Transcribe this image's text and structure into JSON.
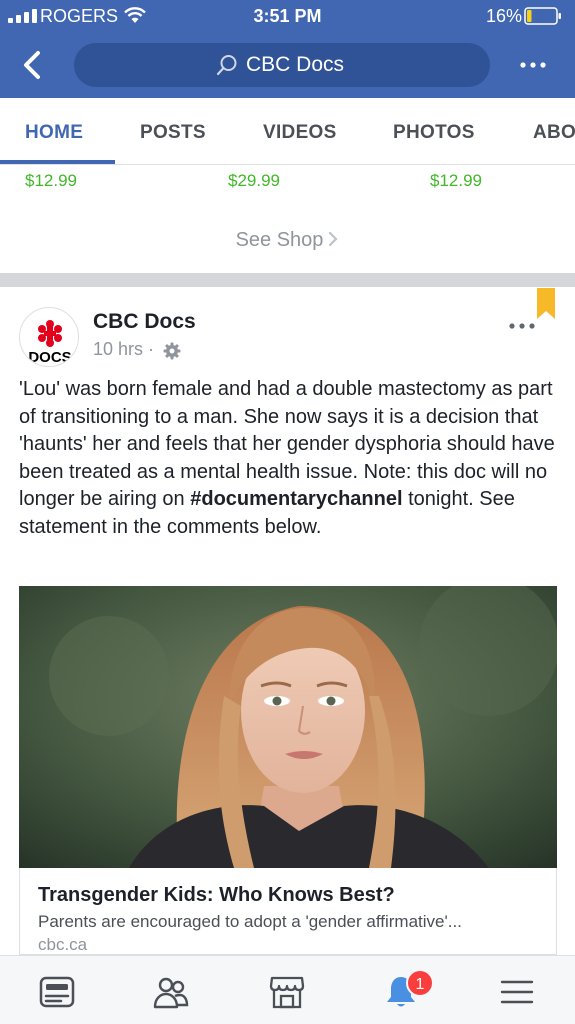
{
  "status_bar": {
    "carrier": "ROGERS",
    "time": "3:51 PM",
    "battery_pct": "16%",
    "battery_level": 0.16
  },
  "header": {
    "search_text": "CBC Docs",
    "back_icon": "chevron-left-icon",
    "more_icon": "ellipsis-icon"
  },
  "tabs": [
    {
      "label": "HOME",
      "active": true
    },
    {
      "label": "POSTS",
      "active": false
    },
    {
      "label": "VIDEOS",
      "active": false
    },
    {
      "label": "PHOTOS",
      "active": false
    },
    {
      "label": "ABO",
      "active": false
    }
  ],
  "shop": {
    "prices": [
      "$12.99",
      "$29.99",
      "$12.99"
    ],
    "see_shop": "See Shop"
  },
  "post": {
    "page_name": "CBC Docs",
    "time_ago": "10 hrs",
    "separator": "·",
    "avatar_text": "DOCS",
    "text_main": "'Lou' was born female and had a double mastectomy as part of transitioning to a man. She now says it is a decision that 'haunts' her and feels that her gender dysphoria should have been treated as a mental health issue. Note: this doc will no longer be airing on ",
    "hashtag": "#documentarychannel",
    "text_tail": " tonight. See statement in the comments below.",
    "link": {
      "title": "Transgender Kids: Who Knows Best?",
      "description": "Parents are encouraged to adopt a 'gender affirmative'...",
      "domain": "cbc.ca"
    }
  },
  "bottom_nav": {
    "items": [
      "news-feed-icon",
      "friends-icon",
      "marketplace-icon",
      "notifications-icon",
      "menu-icon"
    ],
    "notification_count": "1"
  },
  "colors": {
    "brand": "#4267b2",
    "price": "#42b72a",
    "badge": "#fa3e3e",
    "bookmark": "#f7b928"
  }
}
